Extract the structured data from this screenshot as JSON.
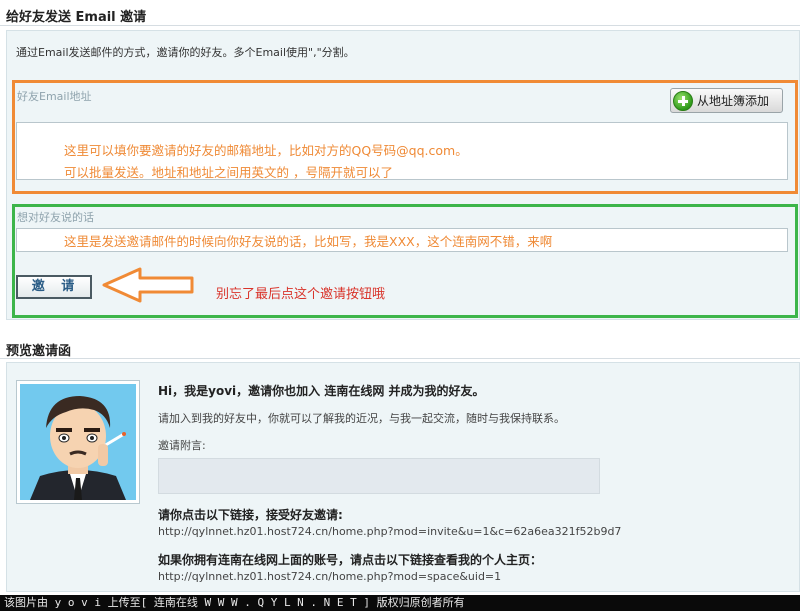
{
  "invite_section": {
    "title": "给好友发送 Email 邀请",
    "intro": "通过Email发送邮件的方式，邀请你的好友。多个Email使用\",\"分割。",
    "email_field_label": "好友Email地址",
    "address_book_button": "从地址簿添加",
    "email_hint_line1": "这里可以填你要邀请的好友的邮箱地址，比如对方的QQ号码@qq.com。",
    "email_hint_line2": "可以批量发送。地址和地址之间用英文的 ，号隔开就可以了",
    "message_field_label": "想对好友说的话",
    "message_hint": "这里是发送邀请邮件的时候向你好友说的话，比如写，我是XXX，这个连南网不错，来啊",
    "invite_button": "邀 请",
    "reminder": "别忘了最后点这个邀请按钮哦"
  },
  "preview_section": {
    "title": "预览邀请函",
    "greeting": "Hi，我是yovi，邀请你也加入 连南在线网 并成为我的好友。",
    "body": "请加入到我的好友中，你就可以了解我的近况，与我一起交流，随时与我保持联系。",
    "memo_label": "邀请附言:",
    "accept_label": "请你点击以下链接，接受好友邀请:",
    "accept_link": "http://qylnnet.hz01.host724.cn/home.php?mod=invite&u=1&c=62a6ea321f52b9d7",
    "account_label": "如果你拥有连南在线网上面的账号，请点击以下链接查看我的个人主页：",
    "profile_link": "http://qylnnet.hz01.host724.cn/home.php?mod=space&uid=1"
  },
  "footer": {
    "text": "该图片由 y o v i  上传至[ 连南在线 W W W . Q Y L N . N E T ]  版权归原创者所有"
  },
  "colors": {
    "orange_annotation": "#f08a35",
    "green_annotation": "#3db54a",
    "red_annotation": "#d9342b",
    "panel_bg": "#eef5f7"
  },
  "icons": [
    "plus-circle-icon",
    "arrow-left-icon",
    "avatar-image"
  ]
}
